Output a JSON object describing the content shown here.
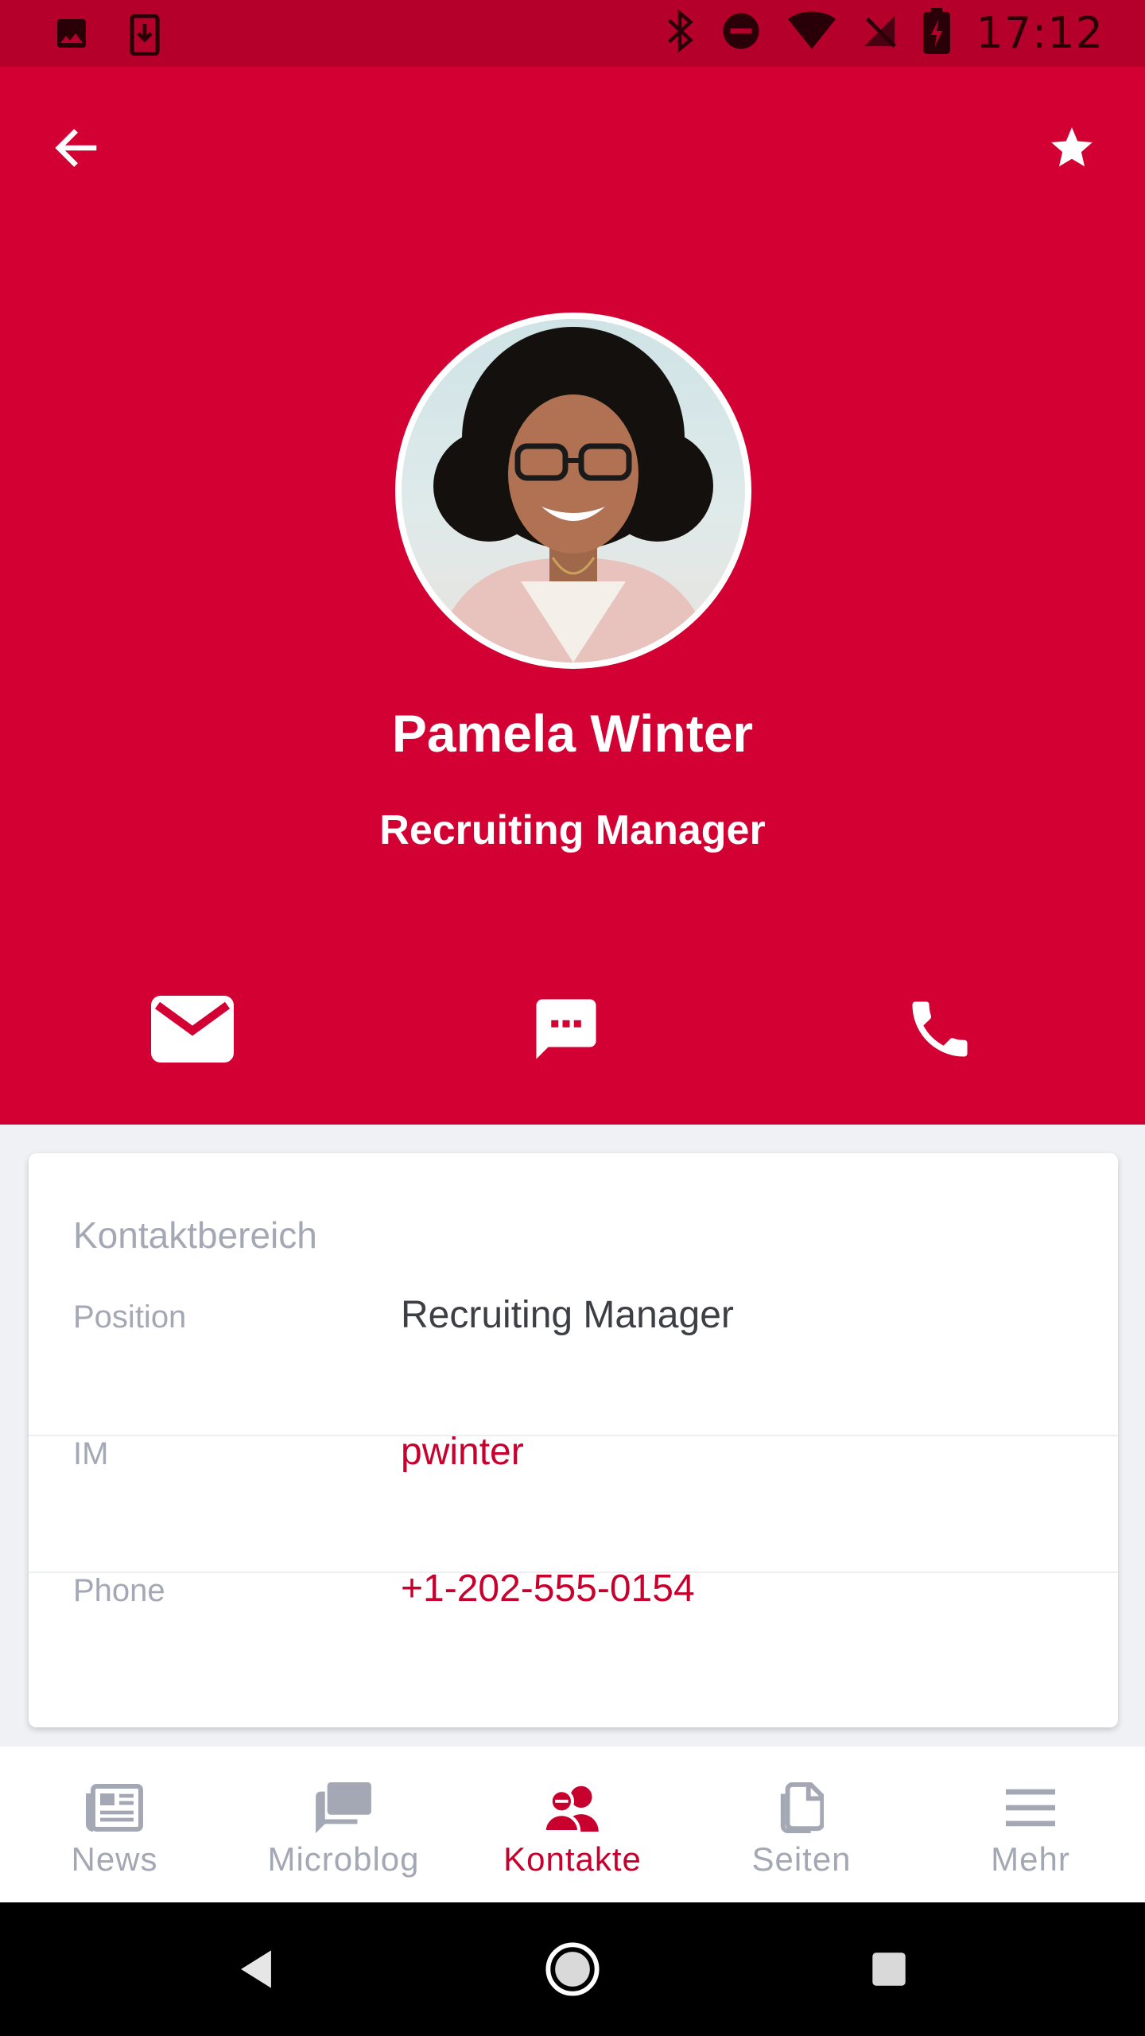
{
  "status_bar": {
    "time": "17:12",
    "icons": [
      "image-icon",
      "download-icon",
      "bluetooth-icon",
      "do-not-disturb-icon",
      "wifi-icon",
      "no-signal-icon",
      "battery-charging-icon"
    ]
  },
  "header": {
    "back_icon": "arrow-left-icon",
    "favorite_icon": "star-icon"
  },
  "profile": {
    "name": "Pamela Winter",
    "title": "Recruiting Manager",
    "actions": [
      {
        "name": "email",
        "icon": "mail-icon"
      },
      {
        "name": "message",
        "icon": "chat-icon"
      },
      {
        "name": "call",
        "icon": "phone-icon"
      }
    ]
  },
  "contact_card": {
    "title": "Kontaktbereich",
    "rows": [
      {
        "label": "Position",
        "value": "Recruiting Manager",
        "link": false
      },
      {
        "label": "IM",
        "value": "pwinter",
        "link": true
      },
      {
        "label": "Phone",
        "value": "+1-202-555-0154",
        "link": true
      }
    ]
  },
  "bottom_nav": {
    "items": [
      {
        "label": "News",
        "icon": "newspaper-icon",
        "active": false
      },
      {
        "label": "Microblog",
        "icon": "chat-bubbles-icon",
        "active": false
      },
      {
        "label": "Kontakte",
        "icon": "contacts-icon",
        "active": true
      },
      {
        "label": "Seiten",
        "icon": "pages-icon",
        "active": false
      },
      {
        "label": "Mehr",
        "icon": "menu-icon",
        "active": false
      }
    ]
  },
  "colors": {
    "brand": "#d30033",
    "status_bar": "#b4002a",
    "link": "#c8002e",
    "muted": "#a3a8b4"
  }
}
